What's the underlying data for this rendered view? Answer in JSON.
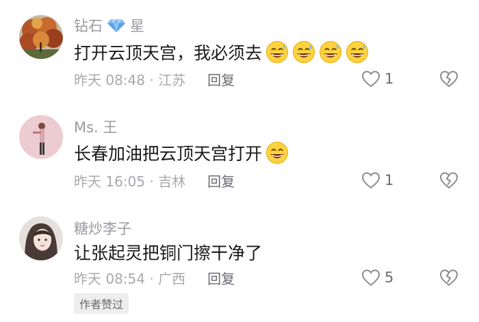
{
  "colors": {
    "username": "#9a9aa0",
    "text": "#1a1a1a",
    "meta": "#a8a8ae",
    "reply": "#6a6a70",
    "badge_bg": "#eeeeee"
  },
  "comments": [
    {
      "username_pre": "钻石",
      "username_post": "星",
      "username_icon": "diamond-icon",
      "text": "打开云顶天宫，我必须去",
      "emoji_icon": "grinning-sweat-face-emoji",
      "emoji_count": 4,
      "time": "昨天 08:48",
      "location": "江苏",
      "reply_label": "回复",
      "likes": "1"
    },
    {
      "username": "Ms. 王",
      "text": "长春加油把云顶天宫打开",
      "emoji_icon": "grinning-face-emoji",
      "emoji_count": 1,
      "time": "昨天 16:05",
      "location": "吉林",
      "reply_label": "回复",
      "likes": "1"
    },
    {
      "username": "糖炒李子",
      "text": "让张起灵把铜门擦干净了",
      "time": "昨天 08:54",
      "location": "广西",
      "reply_label": "回复",
      "likes": "5",
      "badge": "作者赞过"
    }
  ],
  "meta_separator": " · "
}
